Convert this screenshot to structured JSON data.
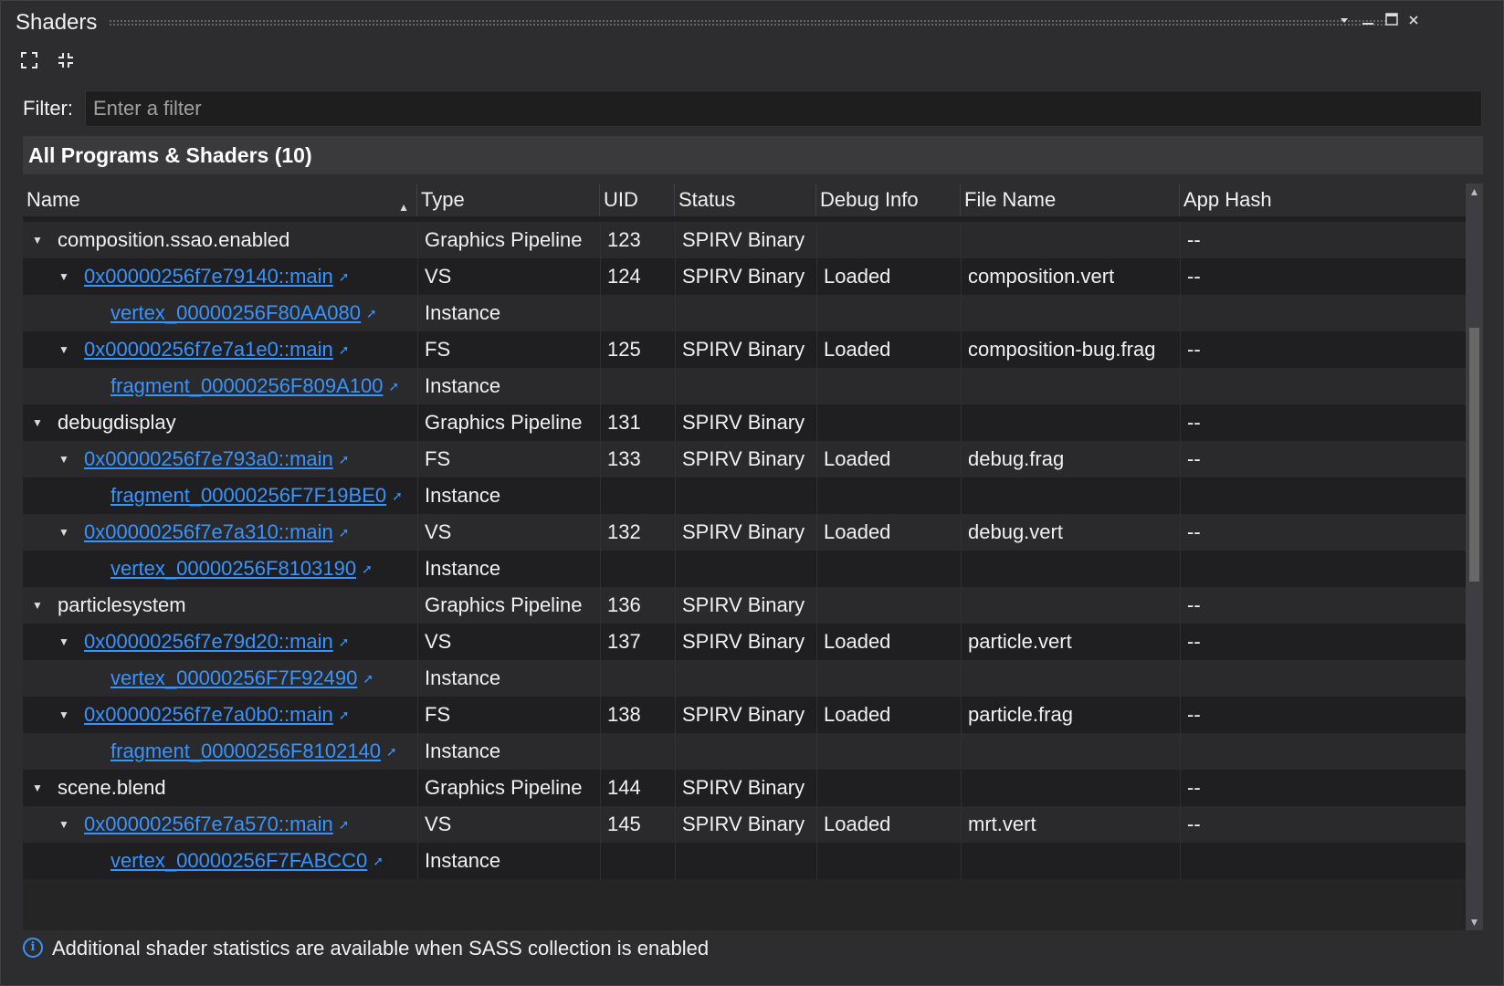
{
  "window": {
    "title": "Shaders",
    "controls": [
      "dropdown-icon",
      "minimize-icon",
      "maximize-icon",
      "close-icon"
    ]
  },
  "toolbar": {
    "expand_all_icon": "expand-all-icon",
    "collapse_all_icon": "collapse-all-icon"
  },
  "filter": {
    "label": "Filter:",
    "placeholder": "Enter a filter",
    "value": ""
  },
  "group": {
    "title": "All Programs & Shaders (10)"
  },
  "table": {
    "columns": [
      "Name",
      "Type",
      "UID",
      "Status",
      "Debug Info",
      "File Name",
      "App Hash"
    ],
    "sort_column": "Name",
    "sort_direction": "ascending",
    "rows": [
      {
        "level": 0,
        "expander": true,
        "name": "composition.ssao.enabled",
        "link": false,
        "type": "Graphics Pipeline",
        "uid": "123",
        "status": "SPIRV Binary",
        "debug": "",
        "file": "",
        "hash": "--"
      },
      {
        "level": 1,
        "expander": true,
        "name": "0x00000256f7e79140::main",
        "link": true,
        "type": "VS",
        "uid": "124",
        "status": "SPIRV Binary",
        "debug": "Loaded",
        "file": "composition.vert",
        "hash": "--"
      },
      {
        "level": 2,
        "expander": false,
        "name": "vertex_00000256F80AA080",
        "link": true,
        "type": "Instance",
        "uid": "",
        "status": "",
        "debug": "",
        "file": "",
        "hash": ""
      },
      {
        "level": 1,
        "expander": true,
        "name": "0x00000256f7e7a1e0::main",
        "link": true,
        "type": "FS",
        "uid": "125",
        "status": "SPIRV Binary",
        "debug": "Loaded",
        "file": "composition-bug.frag",
        "hash": "--"
      },
      {
        "level": 2,
        "expander": false,
        "name": "fragment_00000256F809A100",
        "link": true,
        "type": "Instance",
        "uid": "",
        "status": "",
        "debug": "",
        "file": "",
        "hash": ""
      },
      {
        "level": 0,
        "expander": true,
        "name": "debugdisplay",
        "link": false,
        "type": "Graphics Pipeline",
        "uid": "131",
        "status": "SPIRV Binary",
        "debug": "",
        "file": "",
        "hash": "--"
      },
      {
        "level": 1,
        "expander": true,
        "name": "0x00000256f7e793a0::main",
        "link": true,
        "type": "FS",
        "uid": "133",
        "status": "SPIRV Binary",
        "debug": "Loaded",
        "file": "debug.frag",
        "hash": "--"
      },
      {
        "level": 2,
        "expander": false,
        "name": "fragment_00000256F7F19BE0",
        "link": true,
        "type": "Instance",
        "uid": "",
        "status": "",
        "debug": "",
        "file": "",
        "hash": ""
      },
      {
        "level": 1,
        "expander": true,
        "name": "0x00000256f7e7a310::main",
        "link": true,
        "type": "VS",
        "uid": "132",
        "status": "SPIRV Binary",
        "debug": "Loaded",
        "file": "debug.vert",
        "hash": "--"
      },
      {
        "level": 2,
        "expander": false,
        "name": "vertex_00000256F8103190",
        "link": true,
        "type": "Instance",
        "uid": "",
        "status": "",
        "debug": "",
        "file": "",
        "hash": ""
      },
      {
        "level": 0,
        "expander": true,
        "name": "particlesystem",
        "link": false,
        "type": "Graphics Pipeline",
        "uid": "136",
        "status": "SPIRV Binary",
        "debug": "",
        "file": "",
        "hash": "--"
      },
      {
        "level": 1,
        "expander": true,
        "name": "0x00000256f7e79d20::main",
        "link": true,
        "type": "VS",
        "uid": "137",
        "status": "SPIRV Binary",
        "debug": "Loaded",
        "file": "particle.vert",
        "hash": "--"
      },
      {
        "level": 2,
        "expander": false,
        "name": "vertex_00000256F7F92490",
        "link": true,
        "type": "Instance",
        "uid": "",
        "status": "",
        "debug": "",
        "file": "",
        "hash": ""
      },
      {
        "level": 1,
        "expander": true,
        "name": "0x00000256f7e7a0b0::main",
        "link": true,
        "type": "FS",
        "uid": "138",
        "status": "SPIRV Binary",
        "debug": "Loaded",
        "file": "particle.frag",
        "hash": "--"
      },
      {
        "level": 2,
        "expander": false,
        "name": "fragment_00000256F8102140",
        "link": true,
        "type": "Instance",
        "uid": "",
        "status": "",
        "debug": "",
        "file": "",
        "hash": ""
      },
      {
        "level": 0,
        "expander": true,
        "name": "scene.blend",
        "link": false,
        "type": "Graphics Pipeline",
        "uid": "144",
        "status": "SPIRV Binary",
        "debug": "",
        "file": "",
        "hash": "--"
      },
      {
        "level": 1,
        "expander": true,
        "name": "0x00000256f7e7a570::main",
        "link": true,
        "type": "VS",
        "uid": "145",
        "status": "SPIRV Binary",
        "debug": "Loaded",
        "file": "mrt.vert",
        "hash": "--"
      },
      {
        "level": 2,
        "expander": false,
        "name": "vertex_00000256F7FABCC0",
        "link": true,
        "type": "Instance",
        "uid": "",
        "status": "",
        "debug": "",
        "file": "",
        "hash": ""
      }
    ]
  },
  "status_bar": {
    "icon": "info-icon",
    "text": "Additional shader statistics are available when SASS collection is enabled"
  },
  "colors": {
    "link": "#3794ff",
    "background": "#2d2d30",
    "table_background": "#252526"
  }
}
